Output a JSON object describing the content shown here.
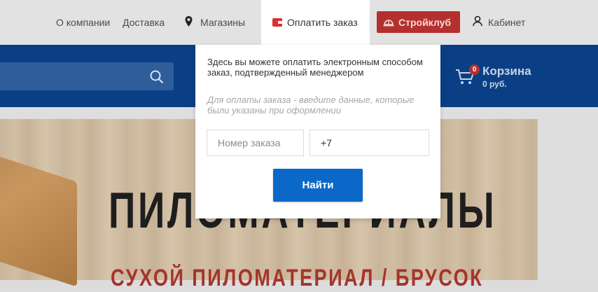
{
  "header": {
    "about_label": "О компании",
    "delivery_label": "Доставка",
    "stores_label": "Магазины",
    "pay_order_label": "Оплатить заказ",
    "club_label": "Стройклуб",
    "cabinet_label": "Кабинет"
  },
  "search": {
    "placeholder": ""
  },
  "cart": {
    "count": "0",
    "title": "Корзина",
    "sum": "0 руб."
  },
  "banner": {
    "title": "ПИЛОМАТЕРИАЛЫ",
    "subtitle": "СУХОЙ ПИЛОМАТЕРИАЛ / БРУСОК"
  },
  "pay_popup": {
    "description": "Здесь вы можете оплатить электронным способом заказ, подтвержденный менеджером",
    "hint": "Для оплаты заказа - введите данные, которые были указаны при оформлении",
    "order_placeholder": "Номер заказа",
    "phone_value": "+7",
    "find_label": "Найти"
  },
  "colors": {
    "brand_blue": "#0a3f86",
    "accent_red": "#b4302e",
    "button_blue": "#0c68c8"
  }
}
